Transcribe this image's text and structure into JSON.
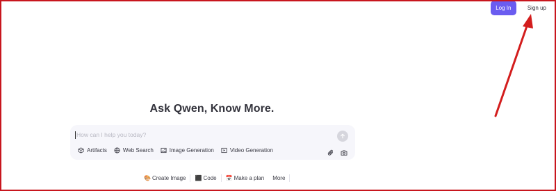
{
  "header": {
    "login_label": "Log In",
    "signup_label": "Sign up"
  },
  "hero": {
    "title": "Ask Qwen, Know More."
  },
  "composer": {
    "placeholder": "How can I help you today?",
    "value": "",
    "tools": [
      {
        "label": "Artifacts",
        "icon": "cube-icon"
      },
      {
        "label": "Web Search",
        "icon": "globe-icon"
      },
      {
        "label": "Image Generation",
        "icon": "image-icon"
      },
      {
        "label": "Video Generation",
        "icon": "video-icon"
      }
    ],
    "right_tools": [
      {
        "icon": "paperclip-icon"
      },
      {
        "icon": "camera-icon"
      }
    ],
    "send_icon": "arrow-up-icon"
  },
  "suggestions": [
    {
      "label": "Create Image",
      "icon": "palette-icon",
      "glyph": "🎨"
    },
    {
      "label": "Code",
      "icon": "code-icon",
      "glyph": "⬛"
    },
    {
      "label": "Make a plan",
      "icon": "calendar-icon",
      "glyph": "📅"
    },
    {
      "label": "More",
      "icon": "",
      "glyph": ""
    }
  ],
  "colors": {
    "accent": "#6a5cf0",
    "annotation_arrow": "#d31d1d",
    "frame_border": "#c8161e"
  }
}
